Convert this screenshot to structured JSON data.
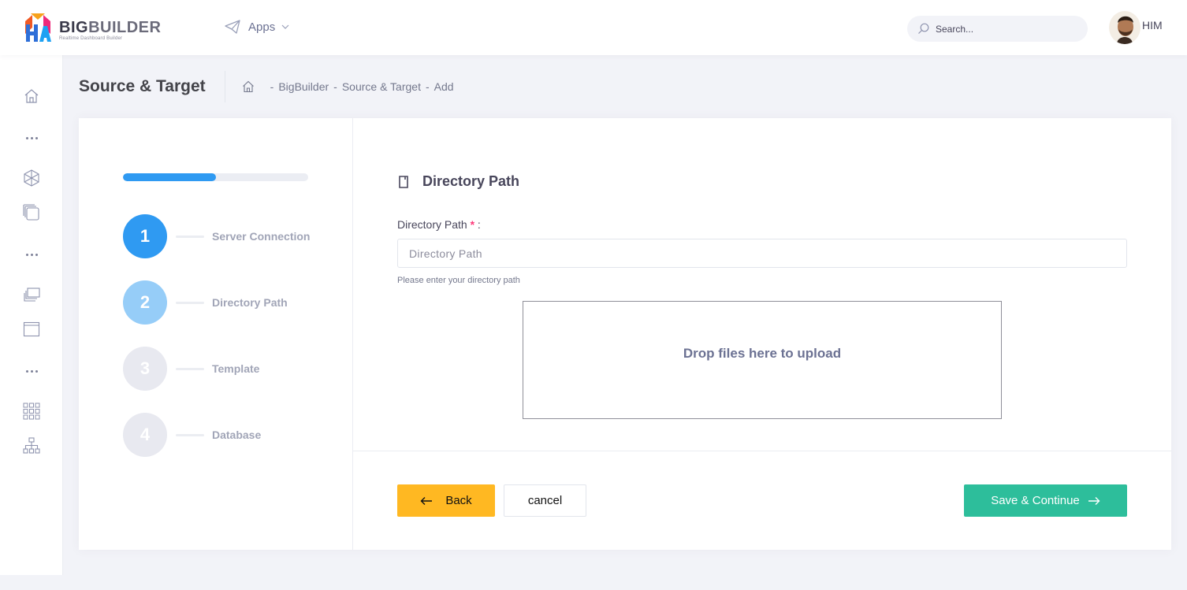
{
  "brand": {
    "name_part1": "BIG",
    "name_part2": "BUILDER",
    "tagline": "Realtime Dashboard Builder"
  },
  "header": {
    "apps_label": "Apps",
    "search_placeholder": "Search...",
    "user_name": "HIM"
  },
  "sidebar": {
    "icons": [
      "home-icon",
      "more-dots-icon",
      "cube-icon",
      "layers-icon",
      "more-dots-icon",
      "stack-icon",
      "window-icon",
      "more-dots-icon",
      "grid-icon",
      "sitemap-icon"
    ]
  },
  "subheader": {
    "title": "Source & Target",
    "breadcrumb": [
      "BigBuilder",
      "Source & Target",
      "Add"
    ]
  },
  "wizard": {
    "progress_percent": 50,
    "steps": [
      {
        "number": "1",
        "label": "Server Connection",
        "state": "done",
        "color": "#2f9af2"
      },
      {
        "number": "2",
        "label": "Directory Path",
        "state": "current",
        "color": "#96cdf8"
      },
      {
        "number": "3",
        "label": "Template",
        "state": "pending",
        "color": "#e8e9f0"
      },
      {
        "number": "4",
        "label": "Database",
        "state": "pending",
        "color": "#e8e9f0"
      }
    ]
  },
  "form": {
    "section_title": "Directory Path",
    "field_label": "Directory Path",
    "required_mark": "*",
    "label_suffix": " :",
    "input_value": "",
    "input_placeholder": "Directory Path",
    "help_text": "Please enter your directory path",
    "dropzone_text": "Drop files here to upload"
  },
  "actions": {
    "back_label": "Back",
    "cancel_label": "cancel",
    "save_label": "Save & Continue"
  },
  "colors": {
    "primary": "#2f9af2",
    "warning": "#ffb822",
    "success": "#2dbe9b"
  }
}
